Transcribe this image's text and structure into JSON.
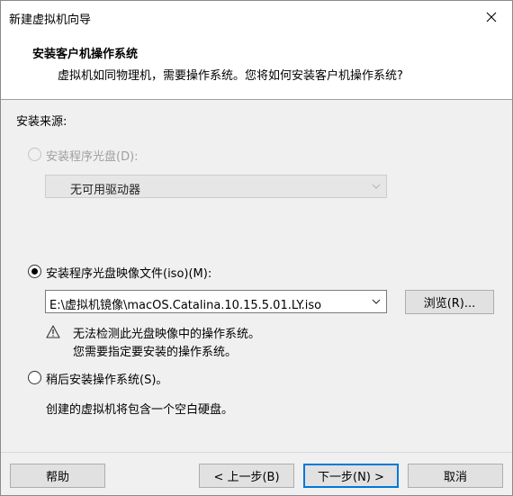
{
  "window": {
    "title": "新建虚拟机向导",
    "close_glyph": "✕"
  },
  "header": {
    "title": "安装客户机操作系统",
    "subtitle": "虚拟机如同物理机，需要操作系统。您将如何安装客户机操作系统?"
  },
  "source": {
    "label": "安装来源:",
    "disc_option": {
      "label": "安装程序光盘(D):",
      "selected": false,
      "enabled": false
    },
    "disc_drive": {
      "value": "无可用驱动器",
      "enabled": false
    },
    "iso_option": {
      "label": "安装程序光盘映像文件(iso)(M):",
      "selected": true
    },
    "iso_path": {
      "value": "E:\\虚拟机镜像\\macOS.Catalina.10.15.5.01.LY.iso"
    },
    "browse_label": "浏览(R)...",
    "warning": {
      "line1": "无法检测此光盘映像中的操作系统。",
      "line2": "您需要指定要安装的操作系统。",
      "icon": "warning-icon"
    },
    "later_option": {
      "label": "稍后安装操作系统(S)。",
      "selected": false
    },
    "later_note": "创建的虚拟机将包含一个空白硬盘。"
  },
  "footer": {
    "help_label": "帮助",
    "back_label": "< 上一步(B)",
    "next_label": "下一步(N) >",
    "cancel_label": "取消"
  },
  "colors": {
    "accent": "#0078d7",
    "dialog_bg": "#f0f0f0",
    "header_bg": "#ffffff",
    "disabled_text": "#a0a0a0"
  }
}
